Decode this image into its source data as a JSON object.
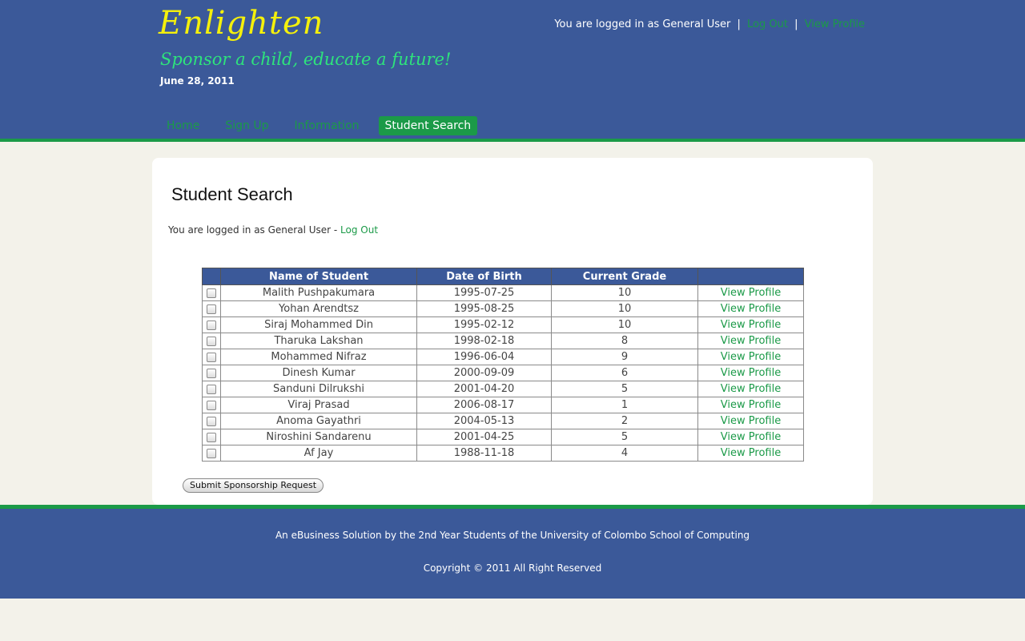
{
  "header": {
    "logo": "Enlighten",
    "tagline": "Sponsor a child, educate a future!",
    "date": "June 28, 2011",
    "user_prefix": "You are logged in as General User",
    "separator": "|",
    "logout_label": "Log Out",
    "view_profile_label": "View Profile"
  },
  "nav": [
    {
      "label": "Home",
      "active": false
    },
    {
      "label": "Sign Up",
      "active": false
    },
    {
      "label": "Information",
      "active": false
    },
    {
      "label": "Student Search",
      "active": true
    }
  ],
  "main": {
    "title": "Student Search",
    "login_text": "You are logged in as General User - ",
    "logout_label": "Log Out"
  },
  "table": {
    "columns": [
      "",
      "Name of Student",
      "Date of Birth",
      "Current Grade",
      ""
    ],
    "rows": [
      {
        "name": "Malith Pushpakumara",
        "dob": "1995-07-25",
        "grade": "10",
        "link": "View Profile"
      },
      {
        "name": "Yohan Arendtsz",
        "dob": "1995-08-25",
        "grade": "10",
        "link": "View Profile"
      },
      {
        "name": "Siraj Mohammed Din",
        "dob": "1995-02-12",
        "grade": "10",
        "link": "View Profile"
      },
      {
        "name": "Tharuka Lakshan",
        "dob": "1998-02-18",
        "grade": "8",
        "link": "View Profile"
      },
      {
        "name": "Mohammed Nifraz",
        "dob": "1996-06-04",
        "grade": "9",
        "link": "View Profile"
      },
      {
        "name": "Dinesh Kumar",
        "dob": "2000-09-09",
        "grade": "6",
        "link": "View Profile"
      },
      {
        "name": "Sanduni Dilrukshi",
        "dob": "2001-04-20",
        "grade": "5",
        "link": "View Profile"
      },
      {
        "name": "Viraj Prasad",
        "dob": "2006-08-17",
        "grade": "1",
        "link": "View Profile"
      },
      {
        "name": "Anoma Gayathri",
        "dob": "2004-05-13",
        "grade": "2",
        "link": "View Profile"
      },
      {
        "name": "Niroshini Sandarenu",
        "dob": "2001-04-25",
        "grade": "5",
        "link": "View Profile"
      },
      {
        "name": "Af Jay",
        "dob": "1988-11-18",
        "grade": "4",
        "link": "View Profile"
      }
    ]
  },
  "submit_label": "Submit Sponsorship Request",
  "footer": {
    "line1": "An eBusiness Solution by the 2nd Year Students of the University of Colombo School of Computing",
    "line2": "Copyright © 2011 All Right Reserved"
  },
  "colors": {
    "header_bg": "#3b5999",
    "accent_green": "#1b9a48",
    "logo_yellow": "#f4f00c",
    "page_bg": "#f3f2ea"
  }
}
